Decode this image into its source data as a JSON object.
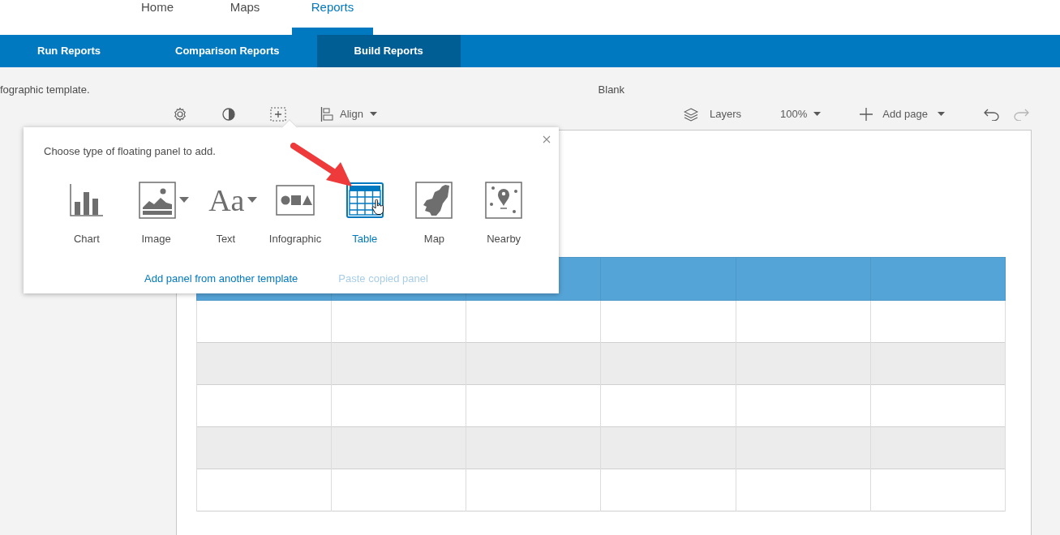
{
  "top_nav": [
    {
      "label": "Home",
      "selected": false
    },
    {
      "label": "Maps",
      "selected": false
    },
    {
      "label": "Reports",
      "selected": true
    }
  ],
  "sub_nav": [
    {
      "label": "Run Reports",
      "selected": false
    },
    {
      "label": "Comparison Reports",
      "selected": false
    },
    {
      "label": "Build Reports",
      "selected": true
    }
  ],
  "description": "fographic template.",
  "template_name": "Blank",
  "toolbar": {
    "align": "Align",
    "layers": "Layers",
    "zoom": "100%",
    "add_page": "Add page",
    "undo_disabled": false,
    "redo_disabled": true
  },
  "popup": {
    "title": "Choose type of floating panel to add.",
    "items": [
      {
        "kind": "chart",
        "label": "Chart",
        "has_menu": false,
        "selected": false
      },
      {
        "kind": "image",
        "label": "Image",
        "has_menu": true,
        "selected": false
      },
      {
        "kind": "text",
        "label": "Text",
        "glyph": "Aa",
        "has_menu": true,
        "selected": false
      },
      {
        "kind": "infographic",
        "label": "Infographic",
        "has_menu": false,
        "selected": false
      },
      {
        "kind": "table",
        "label": "Table",
        "has_menu": false,
        "selected": true
      },
      {
        "kind": "map",
        "label": "Map",
        "has_menu": false,
        "selected": false
      },
      {
        "kind": "nearby",
        "label": "Nearby",
        "has_menu": false,
        "selected": false
      }
    ],
    "links": [
      {
        "label": "Add panel from another template",
        "disabled": false
      },
      {
        "label": "Paste copied panel",
        "disabled": true
      }
    ]
  }
}
